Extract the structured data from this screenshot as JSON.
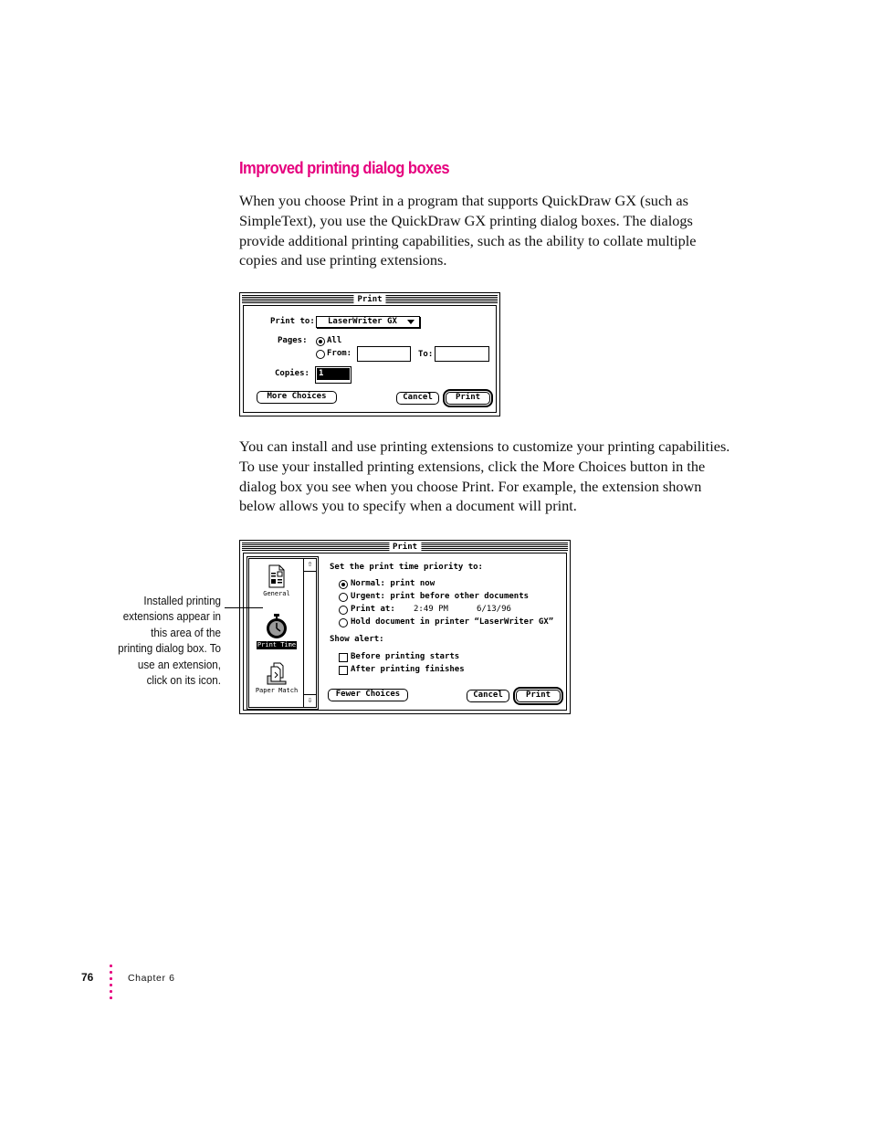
{
  "page": {
    "heading": "Improved printing dialog boxes",
    "paragraph1": "When you choose Print in a program that supports QuickDraw GX (such as SimpleText), you use the QuickDraw GX printing dialog boxes. The dialogs provide additional printing capabilities, such as the ability to collate multiple copies and use printing extensions.",
    "paragraph2": "You can install and use printing extensions to customize your printing capabilities. To use your installed printing extensions, click the More Choices button in the dialog box you see when you choose Print. For example, the extension shown below allows you to specify when a document will print.",
    "accent_color": "#e6007e"
  },
  "dialog1": {
    "title": "Print",
    "print_to_label": "Print to:",
    "printer": "LaserWriter GX",
    "pages_label": "Pages:",
    "pages_all": "All",
    "pages_from": "From:",
    "pages_to": "To:",
    "from_value": "",
    "to_value": "",
    "pages_selected": "All",
    "copies_label": "Copies:",
    "copies_value": "1",
    "more_choices": "More Choices",
    "cancel": "Cancel",
    "print": "Print"
  },
  "dialog2": {
    "title": "Print",
    "extensions": [
      {
        "label": "General",
        "icon": "document-icon",
        "selected": false
      },
      {
        "label": "Print Time",
        "icon": "stopwatch-icon",
        "selected": true
      },
      {
        "label": "Paper Match",
        "icon": "paper-stack-icon",
        "selected": false
      }
    ],
    "priority_heading": "Set the print time priority to:",
    "options": [
      {
        "label": "Normal: print now",
        "selected": true
      },
      {
        "label": "Urgent: print before other documents",
        "selected": false
      },
      {
        "label": "Print at:",
        "selected": false
      },
      {
        "label": "Hold document in printer “LaserWriter GX”",
        "selected": false
      }
    ],
    "print_at_time": "2:49 PM",
    "print_at_date": "6/13/96",
    "alert_heading": "Show alert:",
    "alerts": [
      {
        "label": "Before printing starts",
        "checked": false
      },
      {
        "label": "After printing finishes",
        "checked": false
      }
    ],
    "fewer_choices": "Fewer Choices",
    "cancel": "Cancel",
    "print": "Print"
  },
  "callout": "Installed printing extensions appear in this area of the printing dialog box. To use an extension, click on its icon.",
  "footer": {
    "page_number": "76",
    "chapter": "Chapter 6"
  }
}
